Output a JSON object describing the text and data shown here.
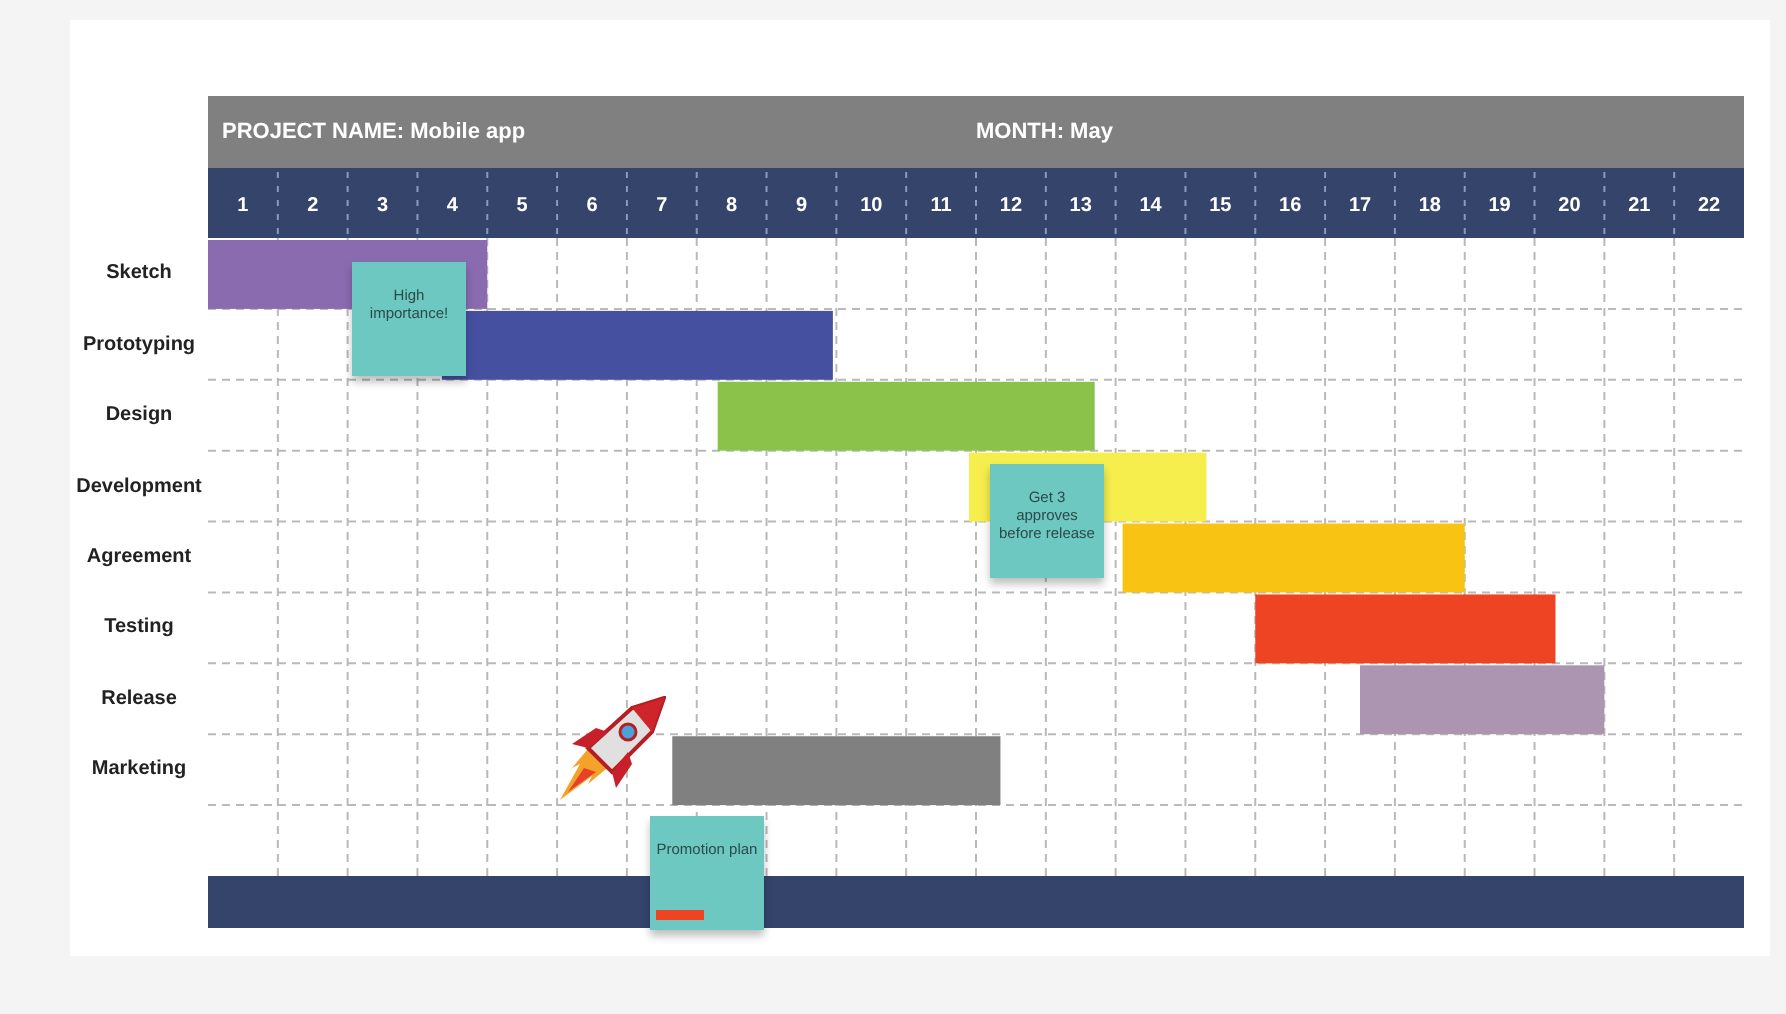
{
  "header": {
    "project": "PROJECT NAME: Mobile app",
    "month": "MONTH: May"
  },
  "days": [
    "1",
    "2",
    "3",
    "4",
    "5",
    "6",
    "7",
    "8",
    "9",
    "10",
    "11",
    "12",
    "13",
    "14",
    "15",
    "16",
    "17",
    "18",
    "19",
    "20",
    "21",
    "22"
  ],
  "tasks": [
    {
      "label": "Sketch",
      "color": "#8a6bb0"
    },
    {
      "label": "Prototyping",
      "color": "#4650a0"
    },
    {
      "label": "Design",
      "color": "#8bc34a"
    },
    {
      "label": "Development",
      "color": "#f5ee4c"
    },
    {
      "label": "Agreement",
      "color": "#f8c313"
    },
    {
      "label": "Testing",
      "color": "#ee4423"
    },
    {
      "label": "Release",
      "color": "#ab95b1"
    },
    {
      "label": "Marketing",
      "color": "#808080"
    }
  ],
  "notes": [
    {
      "text": "High importance!",
      "flagged": false
    },
    {
      "text": "Get 3 approves before release",
      "flagged": false
    },
    {
      "text": "Promotion plan",
      "flagged": true
    }
  ]
}
